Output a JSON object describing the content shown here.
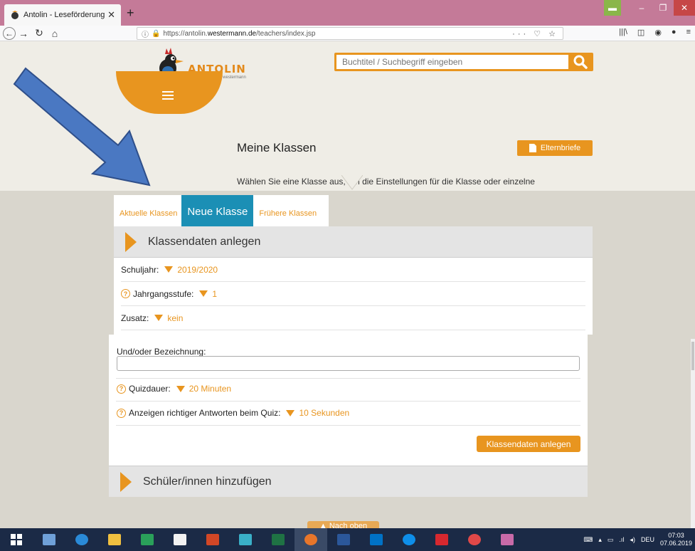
{
  "browser": {
    "tab_title": "Antolin - Leseförderung von Kl",
    "tab_close": "✕",
    "new_tab": "+",
    "url_prefix": "https://antolin.",
    "url_domain": "westermann.de",
    "url_path": "/teachers/index.jsp",
    "url_tools": "··· ♡ ☆",
    "colors": {
      "tabbar": "#c47a98"
    }
  },
  "site": {
    "logo_name": "ANTOLIN",
    "logo_sub": "westermann",
    "search_placeholder": "Buchtitel / Suchbegriff eingeben",
    "title": "Meine Klassen",
    "description": "Wählen Sie eine Klasse aus, um die Einstellungen für die Klasse oder einzelne Schüler/innen vorzunehmen.",
    "letters_button": "Elternbriefe",
    "accent": "#e8951f",
    "tab_active_color": "#1b8fb5"
  },
  "tabs": {
    "current": "Aktuelle Klassen",
    "new": "Neue Klasse",
    "former": "Frühere Klassen"
  },
  "form": {
    "section_title": "Klassendaten anlegen",
    "school_year_label": "Schuljahr:",
    "school_year_value": "2019/2020",
    "grade_label": "Jahrgangsstufe:",
    "grade_value": "1",
    "suffix_label": "Zusatz:",
    "suffix_value": "kein",
    "name_label": "Und/oder Bezeichnung:",
    "name_value": "",
    "quiz_duration_label": "Quizdauer:",
    "quiz_duration_value": "20 Minuten",
    "show_answers_label": "Anzeigen richtiger Antworten beim Quiz:",
    "show_answers_value": "10 Sekunden",
    "submit_button": "Klassendaten anlegen",
    "add_students_title": "Schüler/innen hinzufügen",
    "help_glyph": "?"
  },
  "scroll_top_label": "▲ Nach oben",
  "taskbar": {
    "lang": "DEU",
    "time": "07:03",
    "date": "07.06.2019"
  }
}
